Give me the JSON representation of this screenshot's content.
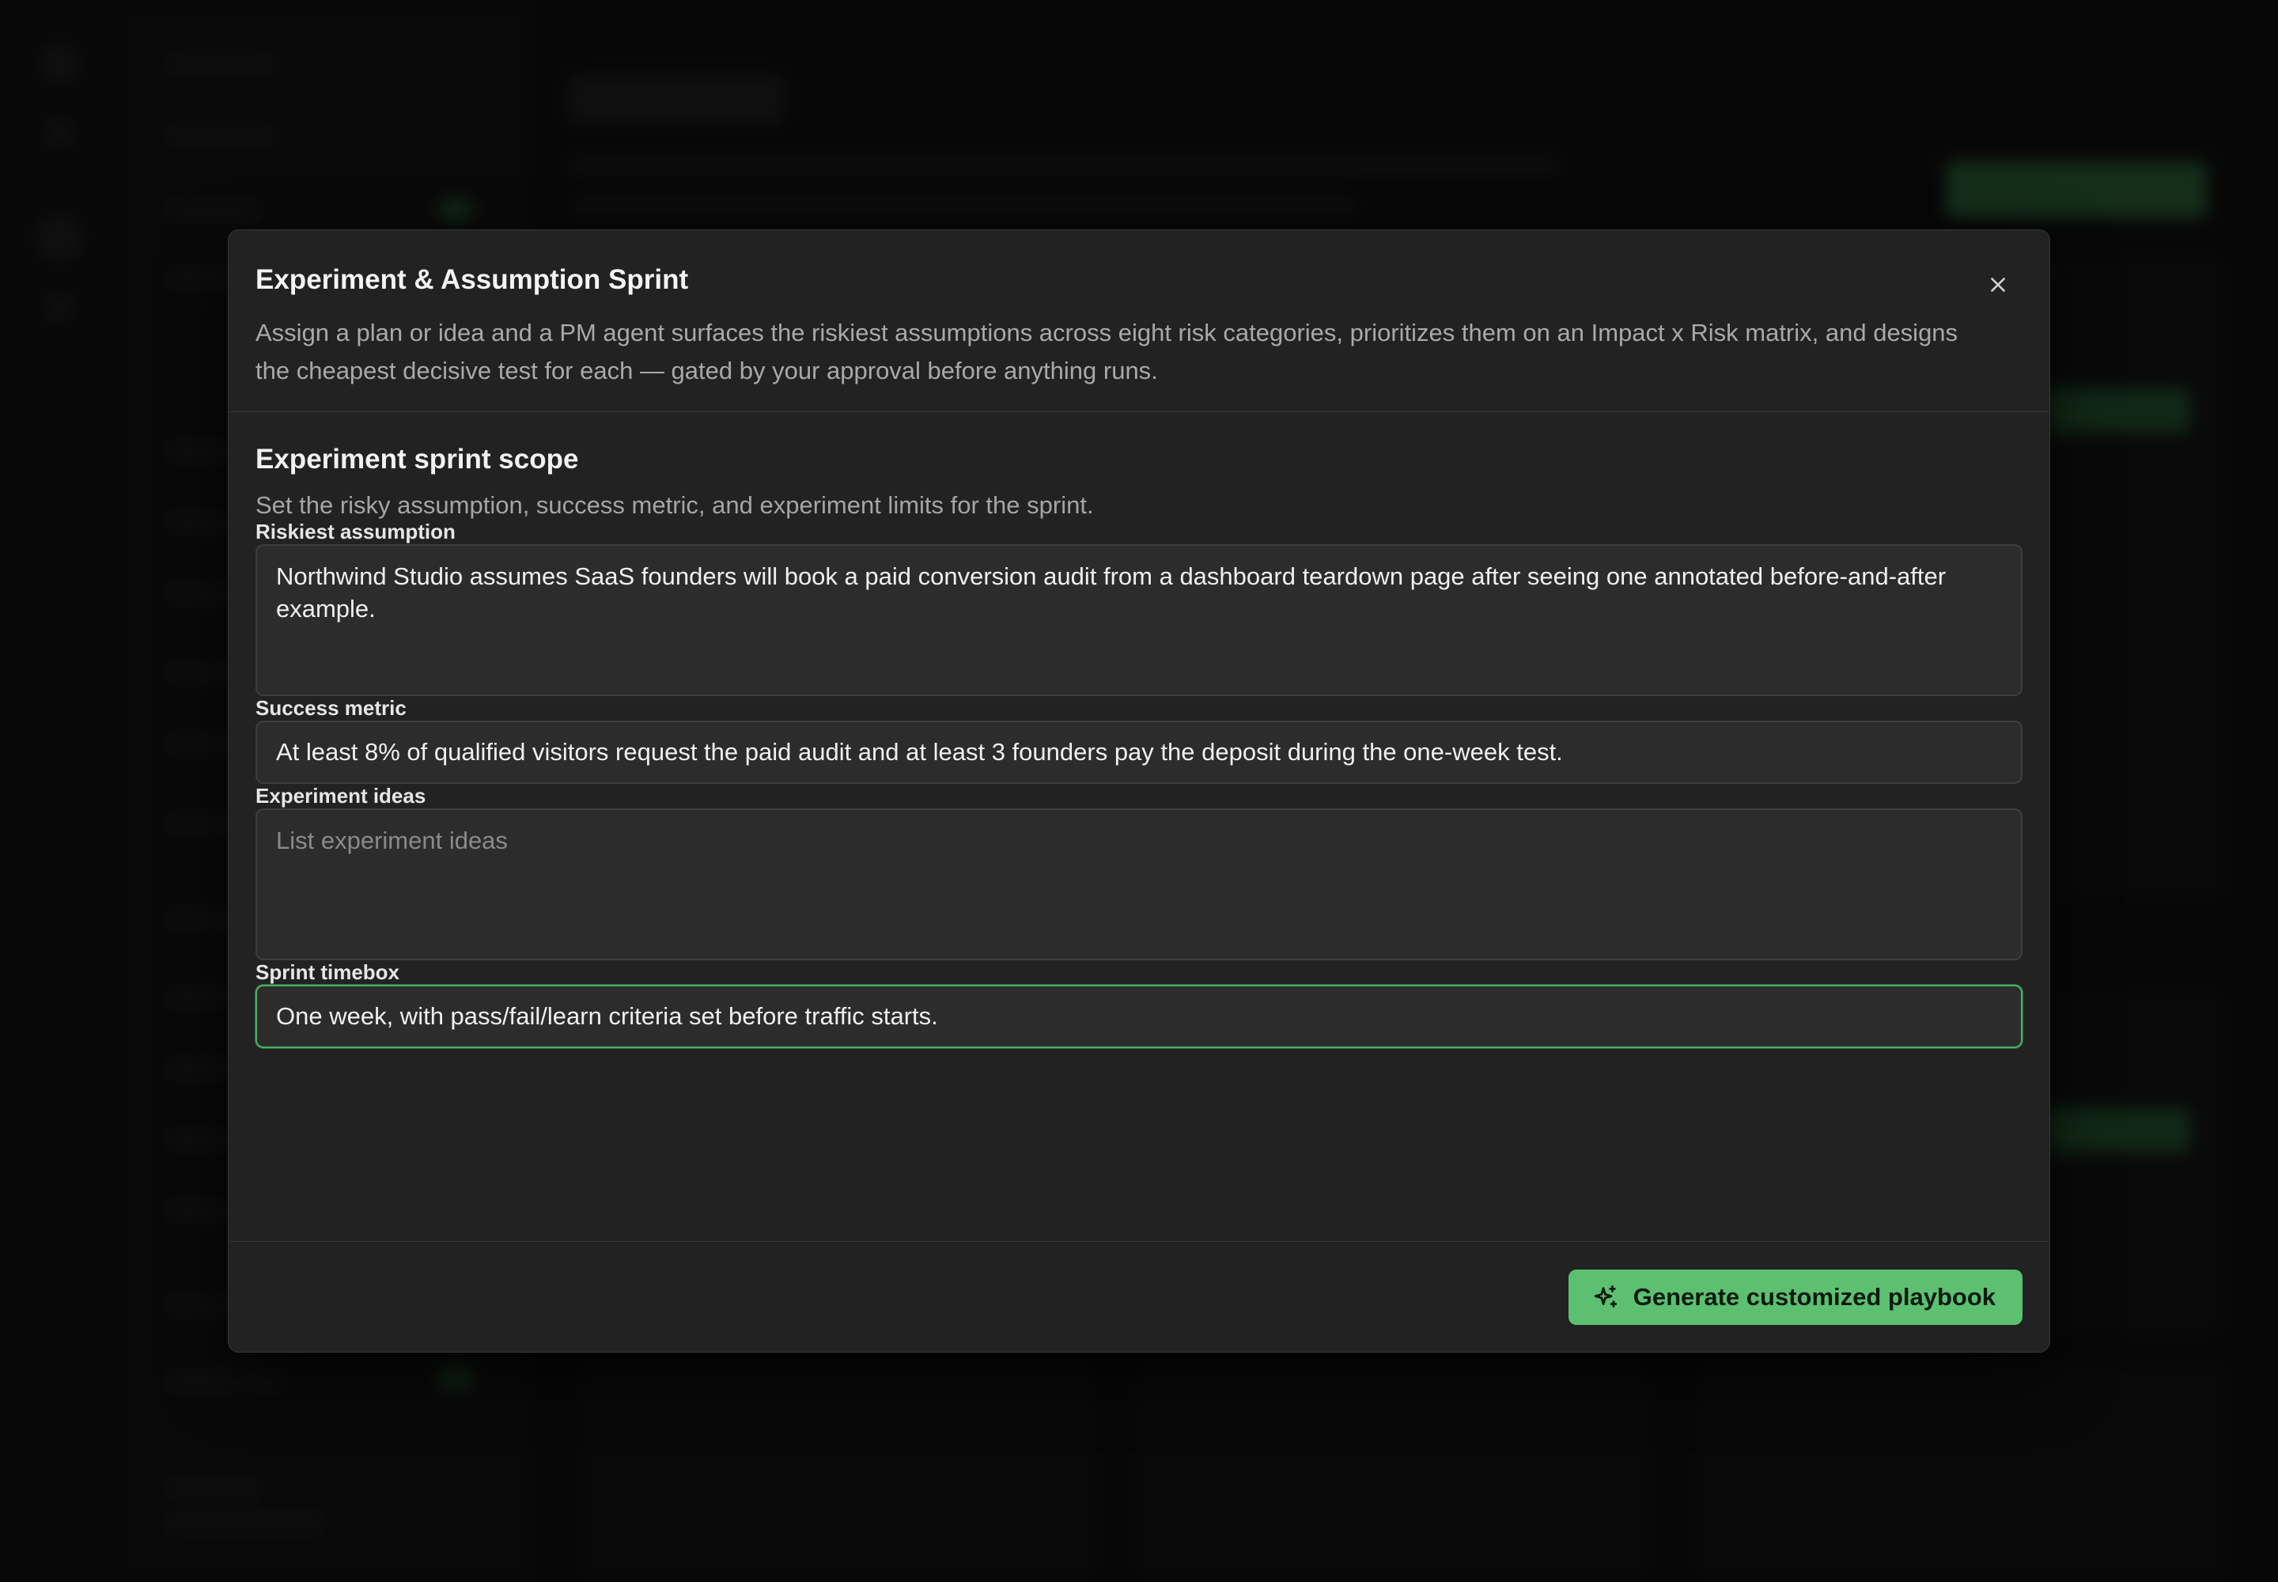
{
  "modal": {
    "title": "Experiment & Assumption Sprint",
    "description": "Assign a plan or idea and a PM agent surfaces the riskiest assumptions across eight risk categories, prioritizes them on an Impact x Risk matrix, and designs the cheapest decisive test for each — gated by your approval before anything runs.",
    "close_label": "×"
  },
  "section": {
    "title": "Experiment sprint scope",
    "description": "Set the risky assumption, success metric, and experiment limits for the sprint."
  },
  "fields": {
    "riskiest_assumption": {
      "label": "Riskiest assumption",
      "value": "Northwind Studio assumes SaaS founders will book a paid conversion audit from a dashboard teardown page after seeing one annotated before-and-after example."
    },
    "success_metric": {
      "label": "Success metric",
      "value": "At least 8% of qualified visitors request the paid audit and at least 3 founders pay the deposit during the one-week test."
    },
    "experiment_ideas": {
      "label": "Experiment ideas",
      "value": "",
      "placeholder": "List experiment ideas"
    },
    "sprint_timebox": {
      "label": "Sprint timebox",
      "value": "One week, with pass/fail/learn criteria set before traffic starts."
    }
  },
  "footer": {
    "generate_label": "Generate customized playbook",
    "generate_icon": "sparkles-icon"
  },
  "colors": {
    "accent": "#5cc070",
    "focus_border": "#4caf64",
    "modal_bg": "#222222"
  }
}
